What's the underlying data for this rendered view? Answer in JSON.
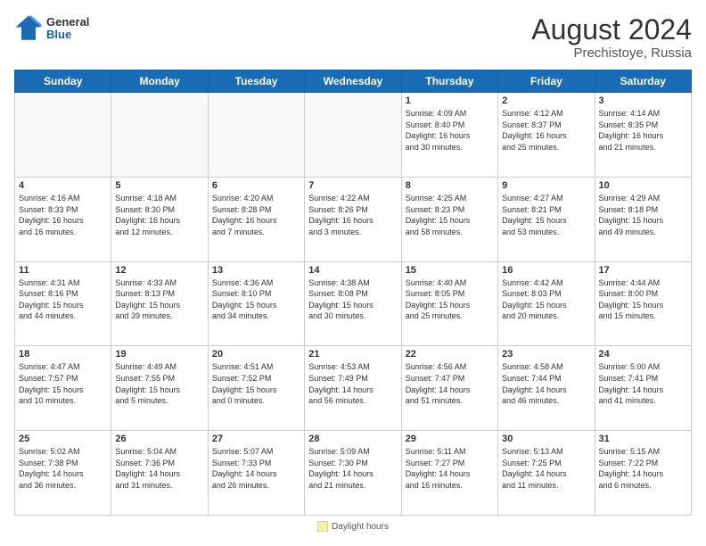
{
  "header": {
    "logo_line1": "General",
    "logo_line2": "Blue",
    "title": "August 2024",
    "subtitle": "Prechistoye, Russia"
  },
  "weekdays": [
    "Sunday",
    "Monday",
    "Tuesday",
    "Wednesday",
    "Thursday",
    "Friday",
    "Saturday"
  ],
  "weeks": [
    [
      {
        "day": "",
        "info": ""
      },
      {
        "day": "",
        "info": ""
      },
      {
        "day": "",
        "info": ""
      },
      {
        "day": "",
        "info": ""
      },
      {
        "day": "1",
        "info": "Sunrise: 4:09 AM\nSunset: 8:40 PM\nDaylight: 16 hours\nand 30 minutes."
      },
      {
        "day": "2",
        "info": "Sunrise: 4:12 AM\nSunset: 8:37 PM\nDaylight: 16 hours\nand 25 minutes."
      },
      {
        "day": "3",
        "info": "Sunrise: 4:14 AM\nSunset: 8:35 PM\nDaylight: 16 hours\nand 21 minutes."
      }
    ],
    [
      {
        "day": "4",
        "info": "Sunrise: 4:16 AM\nSunset: 8:33 PM\nDaylight: 16 hours\nand 16 minutes."
      },
      {
        "day": "5",
        "info": "Sunrise: 4:18 AM\nSunset: 8:30 PM\nDaylight: 16 hours\nand 12 minutes."
      },
      {
        "day": "6",
        "info": "Sunrise: 4:20 AM\nSunset: 8:28 PM\nDaylight: 16 hours\nand 7 minutes."
      },
      {
        "day": "7",
        "info": "Sunrise: 4:22 AM\nSunset: 8:26 PM\nDaylight: 16 hours\nand 3 minutes."
      },
      {
        "day": "8",
        "info": "Sunrise: 4:25 AM\nSunset: 8:23 PM\nDaylight: 15 hours\nand 58 minutes."
      },
      {
        "day": "9",
        "info": "Sunrise: 4:27 AM\nSunset: 8:21 PM\nDaylight: 15 hours\nand 53 minutes."
      },
      {
        "day": "10",
        "info": "Sunrise: 4:29 AM\nSunset: 8:18 PM\nDaylight: 15 hours\nand 49 minutes."
      }
    ],
    [
      {
        "day": "11",
        "info": "Sunrise: 4:31 AM\nSunset: 8:16 PM\nDaylight: 15 hours\nand 44 minutes."
      },
      {
        "day": "12",
        "info": "Sunrise: 4:33 AM\nSunset: 8:13 PM\nDaylight: 15 hours\nand 39 minutes."
      },
      {
        "day": "13",
        "info": "Sunrise: 4:36 AM\nSunset: 8:10 PM\nDaylight: 15 hours\nand 34 minutes."
      },
      {
        "day": "14",
        "info": "Sunrise: 4:38 AM\nSunset: 8:08 PM\nDaylight: 15 hours\nand 30 minutes."
      },
      {
        "day": "15",
        "info": "Sunrise: 4:40 AM\nSunset: 8:05 PM\nDaylight: 15 hours\nand 25 minutes."
      },
      {
        "day": "16",
        "info": "Sunrise: 4:42 AM\nSunset: 8:03 PM\nDaylight: 15 hours\nand 20 minutes."
      },
      {
        "day": "17",
        "info": "Sunrise: 4:44 AM\nSunset: 8:00 PM\nDaylight: 15 hours\nand 15 minutes."
      }
    ],
    [
      {
        "day": "18",
        "info": "Sunrise: 4:47 AM\nSunset: 7:57 PM\nDaylight: 15 hours\nand 10 minutes."
      },
      {
        "day": "19",
        "info": "Sunrise: 4:49 AM\nSunset: 7:55 PM\nDaylight: 15 hours\nand 5 minutes."
      },
      {
        "day": "20",
        "info": "Sunrise: 4:51 AM\nSunset: 7:52 PM\nDaylight: 15 hours\nand 0 minutes."
      },
      {
        "day": "21",
        "info": "Sunrise: 4:53 AM\nSunset: 7:49 PM\nDaylight: 14 hours\nand 56 minutes."
      },
      {
        "day": "22",
        "info": "Sunrise: 4:56 AM\nSunset: 7:47 PM\nDaylight: 14 hours\nand 51 minutes."
      },
      {
        "day": "23",
        "info": "Sunrise: 4:58 AM\nSunset: 7:44 PM\nDaylight: 14 hours\nand 46 minutes."
      },
      {
        "day": "24",
        "info": "Sunrise: 5:00 AM\nSunset: 7:41 PM\nDaylight: 14 hours\nand 41 minutes."
      }
    ],
    [
      {
        "day": "25",
        "info": "Sunrise: 5:02 AM\nSunset: 7:38 PM\nDaylight: 14 hours\nand 36 minutes."
      },
      {
        "day": "26",
        "info": "Sunrise: 5:04 AM\nSunset: 7:36 PM\nDaylight: 14 hours\nand 31 minutes."
      },
      {
        "day": "27",
        "info": "Sunrise: 5:07 AM\nSunset: 7:33 PM\nDaylight: 14 hours\nand 26 minutes."
      },
      {
        "day": "28",
        "info": "Sunrise: 5:09 AM\nSunset: 7:30 PM\nDaylight: 14 hours\nand 21 minutes."
      },
      {
        "day": "29",
        "info": "Sunrise: 5:11 AM\nSunset: 7:27 PM\nDaylight: 14 hours\nand 16 minutes."
      },
      {
        "day": "30",
        "info": "Sunrise: 5:13 AM\nSunset: 7:25 PM\nDaylight: 14 hours\nand 11 minutes."
      },
      {
        "day": "31",
        "info": "Sunrise: 5:15 AM\nSunset: 7:22 PM\nDaylight: 14 hours\nand 6 minutes."
      }
    ]
  ],
  "footer": {
    "legend_label": "Daylight hours"
  }
}
